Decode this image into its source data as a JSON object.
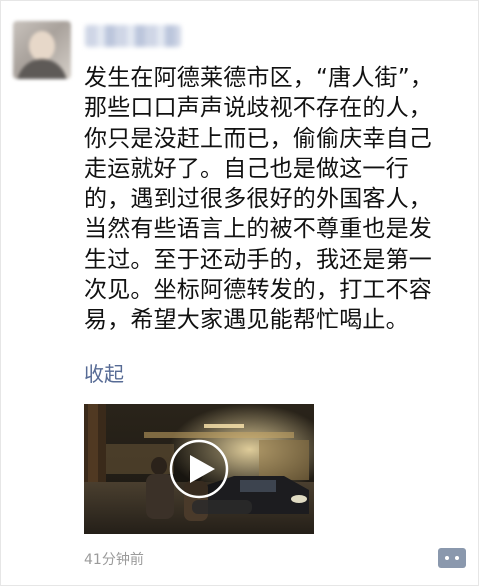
{
  "post": {
    "lines": [
      "发生在阿德莱德市区，“唐人街”，",
      "那些口口声声说歧视不存在的人，",
      "你只是没赶上而已，偷偷庆幸自己",
      "走运就好了。自己也是做这一行",
      "的，遇到过很多很好的外国客人，",
      "当然有些语言上的被不尊重也是发",
      "生过。至于还动手的，我还是第一",
      "次见。坐标阿德转发的，打工不容",
      "易，希望大家遇见能帮忙喝止。"
    ],
    "collapse_label": "收起",
    "timestamp": "41分钟前"
  },
  "video": {
    "play_icon": "play-icon"
  },
  "colors": {
    "link": "#576b95",
    "text": "#111111",
    "meta": "#9b9b9b",
    "comment_button": "#8a98ad"
  }
}
